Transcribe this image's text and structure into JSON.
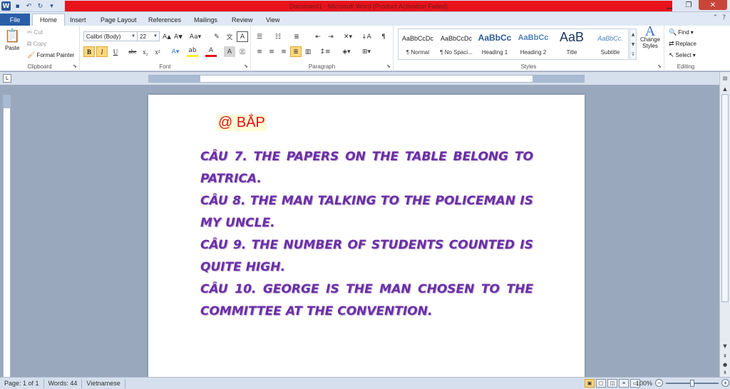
{
  "app": {
    "title": "Document1 - Microsoft Word (Product Activation Failed)",
    "quick_access": [
      "word-logo-icon",
      "save-icon",
      "undo-icon",
      "redo-icon",
      "customize-qat-icon"
    ]
  },
  "tabs": {
    "file": "File",
    "items": [
      "Home",
      "Insert",
      "Page Layout",
      "References",
      "Mailings",
      "Review",
      "View"
    ],
    "active": "Home"
  },
  "ribbon": {
    "clipboard": {
      "label": "Clipboard",
      "paste": "Paste",
      "cut": "Cut",
      "copy": "Copy",
      "format_painter": "Format Painter"
    },
    "font": {
      "label": "Font",
      "font_name": "Calibri (Body)",
      "font_size": "22",
      "buttons": [
        "B",
        "I",
        "U",
        "abc",
        "x₂",
        "x²"
      ]
    },
    "paragraph": {
      "label": "Paragraph"
    },
    "styles": {
      "label": "Styles",
      "items": [
        {
          "preview": "AaBbCcDc",
          "name": "¶ Normal"
        },
        {
          "preview": "AaBbCcDc",
          "name": "¶ No Spaci..."
        },
        {
          "preview": "AaBbCc",
          "name": "Heading 1"
        },
        {
          "preview": "AaBbCc",
          "name": "Heading 2"
        },
        {
          "preview": "AaB",
          "name": "Title"
        },
        {
          "preview": "AaBbCc.",
          "name": "Subtitle"
        }
      ],
      "change_styles": "Change Styles"
    },
    "editing": {
      "label": "Editing",
      "find": "Find",
      "replace": "Replace",
      "select": "Select"
    }
  },
  "document": {
    "heading": "@ BẮP",
    "paragraphs": [
      "CÂU 7. THE PAPERS ON THE TABLE BELONG TO PATRICA.",
      "CÂU 8. THE MAN TALKING TO THE POLICEMAN IS MY UNCLE.",
      "CÂU 9. THE NUMBER OF STUDENTS COUNTED IS QUITE HIGH.",
      "CÂU 10. GEORGE IS THE MAN CHOSEN TO THE COMMITTEE AT THE CONVENTION."
    ],
    "heading_color": "#e0101a",
    "text_color": "#6b2fa6"
  },
  "statusbar": {
    "page": "Page: 1 of 1",
    "words": "Words: 44",
    "language": "Vietnamese",
    "zoom": "100%"
  }
}
